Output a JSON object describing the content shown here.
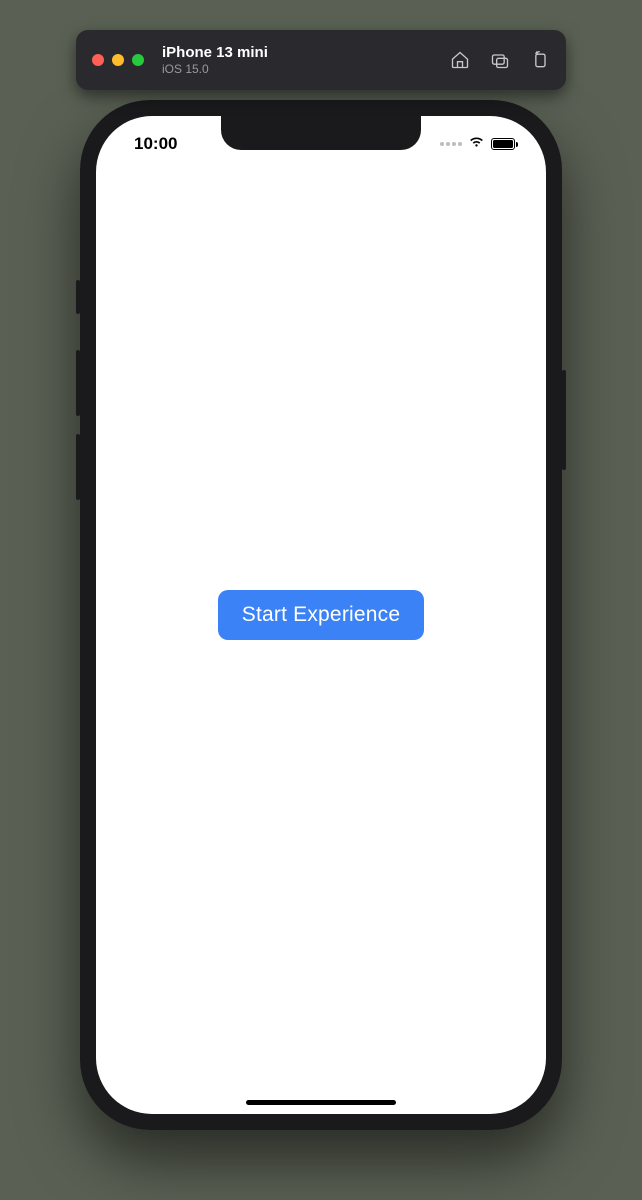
{
  "toolbar": {
    "title": "iPhone 13 mini",
    "subtitle": "iOS 15.0"
  },
  "statusbar": {
    "time": "10:00"
  },
  "app": {
    "start_button_label": "Start Experience"
  }
}
